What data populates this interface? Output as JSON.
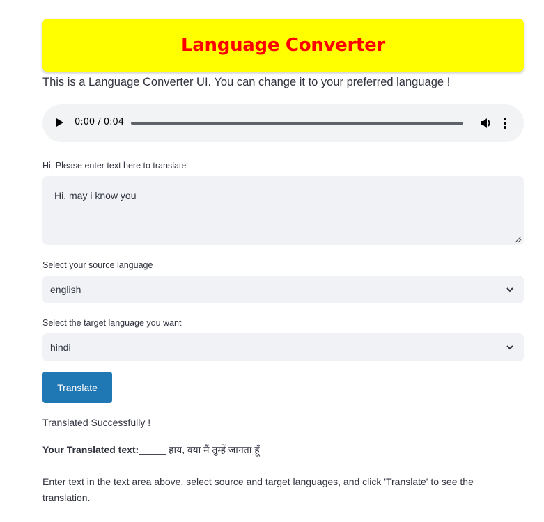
{
  "header": {
    "title": "Language Converter",
    "background_color": "#ffff00",
    "title_color": "#ff0000"
  },
  "intro_text": "This is a Language Converter UI. You can change it to your preferred language !",
  "audio_player": {
    "time_display": "0:00 / 0:04",
    "icons": [
      "play-icon",
      "volume-icon",
      "more-options-icon"
    ]
  },
  "text_input": {
    "label": "Hi, Please enter text here to translate",
    "value": "Hi, may i know you"
  },
  "source_language": {
    "label": "Select your source language",
    "selected": "english"
  },
  "target_language": {
    "label": "Select the target language you want",
    "selected": "hindi"
  },
  "translate_button": {
    "label": "Translate",
    "color": "#1f77b4"
  },
  "status_text": "Translated Successfully !",
  "result": {
    "label": "Your Translated text:",
    "separator": "_____",
    "value": " हाय, क्या मैं तुम्हें जानता हूँ"
  },
  "hint_text": "Enter text in the text area above, select source and target languages, and click 'Translate' to see the translation."
}
